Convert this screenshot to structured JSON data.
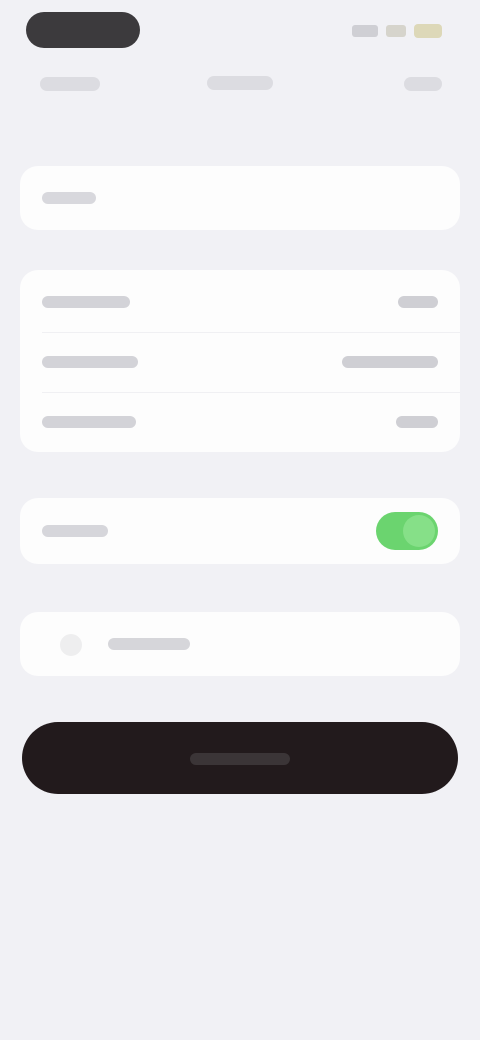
{
  "status_bar": {
    "time": "",
    "icons": [
      "cellular-signal-icon",
      "wifi-icon",
      "battery-icon"
    ]
  },
  "nav": {
    "left_label": "",
    "title": "",
    "right_label": ""
  },
  "form": {
    "name_value": "",
    "name_placeholder": ""
  },
  "details": {
    "rows": [
      {
        "label": "",
        "value": ""
      },
      {
        "label": "",
        "value": ""
      },
      {
        "label": "",
        "value": ""
      }
    ]
  },
  "toggle": {
    "label": "",
    "on": true
  },
  "extra_row": {
    "icon": "plus-circle-icon",
    "label": ""
  },
  "primary_button": {
    "label": ""
  },
  "colors": {
    "background": "#f1f1f5",
    "card": "#fdfdfd",
    "toggle_on": "#6bd46f",
    "button": "#221a1c"
  }
}
